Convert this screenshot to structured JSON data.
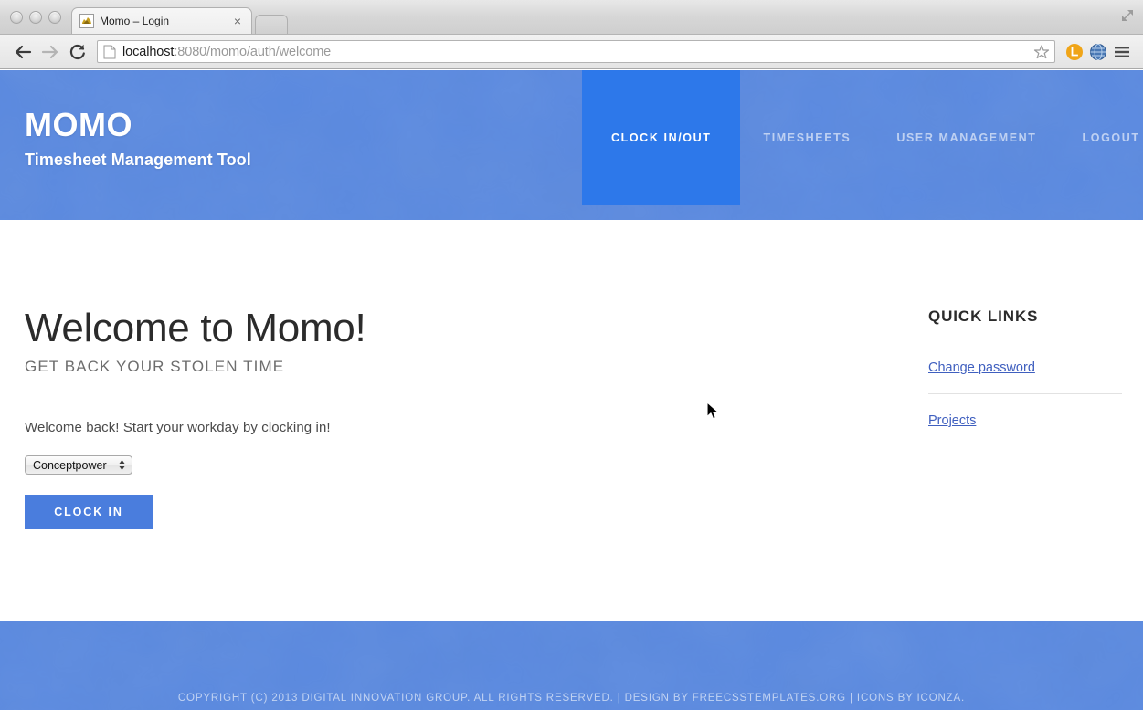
{
  "browser": {
    "tab": {
      "title": "Momo – Login",
      "favicon": "momo-favicon",
      "close_label": "×"
    },
    "nav": {
      "back": "back-arrow",
      "forward": "forward-arrow",
      "reload": "reload-arrow"
    },
    "omnibox": {
      "url_host": "localhost",
      "url_rest": ":8080/momo/auth/welcome",
      "page_icon": "document-icon",
      "star": "bookmark-star-icon"
    },
    "extensions": [
      {
        "name": "lastpass-extension-icon",
        "glyph": "L",
        "color": "#f0a518"
      },
      {
        "name": "globe-extension-icon",
        "glyph": "",
        "color": "#4a79b5"
      }
    ],
    "menu": "hamburger-menu-icon",
    "fullscreen": "fullscreen-icon"
  },
  "site": {
    "brand": {
      "title": "MOMO",
      "subtitle": "Timesheet Management Tool"
    },
    "nav_items": [
      {
        "label": "CLOCK IN/OUT",
        "active": true
      },
      {
        "label": "TIMESHEETS",
        "active": false
      },
      {
        "label": "USER MANAGEMENT",
        "active": false
      },
      {
        "label": "LOGOUT",
        "active": false
      }
    ],
    "main": {
      "heading": "Welcome to Momo!",
      "subheading": "GET BACK YOUR STOLEN TIME",
      "lead": "Welcome back! Start your workday by clocking in!",
      "project_select_value": "Conceptpower",
      "clock_button": "CLOCK IN"
    },
    "sidebar": {
      "title": "QUICK LINKS",
      "links": [
        {
          "label": "Change password"
        },
        {
          "label": "Projects"
        }
      ]
    },
    "footer": {
      "text": "COPYRIGHT (C) 2013 DIGITAL INNOVATION GROUP. ALL RIGHTS RESERVED. | DESIGN BY FREECSSTEMPLATES.ORG | ICONS BY ICONZA."
    }
  },
  "colors": {
    "header_blue": "#5b8ae0",
    "active_nav_blue": "#2d78ea",
    "button_blue": "#4a7ddd",
    "link_blue": "#3f5fbf"
  }
}
